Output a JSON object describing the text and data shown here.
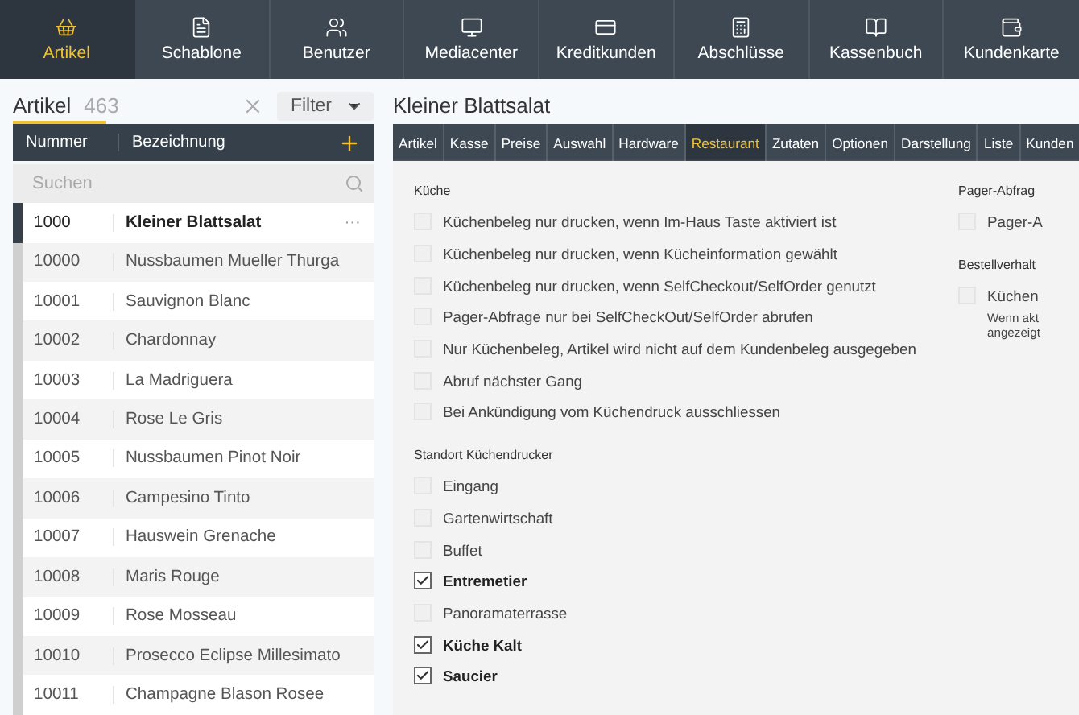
{
  "nav": [
    {
      "label": "Artikel",
      "selected": true
    },
    {
      "label": "Schablone",
      "selected": false
    },
    {
      "label": "Benutzer",
      "selected": false
    },
    {
      "label": "Mediacenter",
      "selected": false
    },
    {
      "label": "Kreditkunden",
      "selected": false
    },
    {
      "label": "Abschlüsse",
      "selected": false
    },
    {
      "label": "Kassenbuch",
      "selected": false
    },
    {
      "label": "Kundenkarte",
      "selected": false
    }
  ],
  "list": {
    "title": "Artikel",
    "count": "463",
    "filter": "Filter",
    "columns": [
      "Nummer",
      "Bezeichnung"
    ],
    "search": {
      "placeholder": "Suchen"
    },
    "rows": [
      {
        "number": "1000",
        "name": "Kleiner Blattsalat",
        "selected": true,
        "more": "···"
      },
      {
        "number": "10000",
        "name": "Nussbaumen Mueller Thurga",
        "selected": false
      },
      {
        "number": "10001",
        "name": "Sauvignon Blanc",
        "selected": false
      },
      {
        "number": "10002",
        "name": "Chardonnay",
        "selected": false
      },
      {
        "number": "10003",
        "name": "La Madriguera",
        "selected": false
      },
      {
        "number": "10004",
        "name": "Rose Le Gris",
        "selected": false
      },
      {
        "number": "10005",
        "name": "Nussbaumen Pinot Noir",
        "selected": false
      },
      {
        "number": "10006",
        "name": "Campesino Tinto",
        "selected": false
      },
      {
        "number": "10007",
        "name": "Hauswein Grenache",
        "selected": false
      },
      {
        "number": "10008",
        "name": "Maris Rouge",
        "selected": false
      },
      {
        "number": "10009",
        "name": "Rose Mosseau",
        "selected": false
      },
      {
        "number": "10010",
        "name": "Prosecco Eclipse Millesimato",
        "selected": false
      },
      {
        "number": "10011",
        "name": "Champagne Blason Rosee",
        "selected": false
      }
    ]
  },
  "detail": {
    "title": "Kleiner Blattsalat",
    "tabs": [
      {
        "label": "Artikel",
        "selected": false
      },
      {
        "label": "Kasse",
        "selected": false
      },
      {
        "label": "Preise",
        "selected": false
      },
      {
        "label": "Auswahl",
        "selected": false
      },
      {
        "label": "Hardware",
        "selected": false
      },
      {
        "label": "Restaurant",
        "selected": true
      },
      {
        "label": "Zutaten",
        "selected": false
      },
      {
        "label": "Optionen",
        "selected": false
      },
      {
        "label": "Darstellung",
        "selected": false
      },
      {
        "label": "Liste",
        "selected": false
      },
      {
        "label": "Kunden",
        "selected": false
      }
    ],
    "sections": [
      {
        "heading": "Küche",
        "options": [
          {
            "label": "Küchenbeleg nur drucken, wenn Im-Haus Taste aktiviert ist",
            "checked": false
          },
          {
            "label": "Küchenbeleg nur drucken, wenn Kücheinformation gewählt",
            "checked": false
          },
          {
            "label": "Küchenbeleg nur drucken, wenn SelfCheckout/SelfOrder genutzt",
            "checked": false
          },
          {
            "label": "Pager-Abfrage nur bei SelfCheckOut/SelfOrder abrufen",
            "checked": false
          },
          {
            "label": "Nur Küchenbeleg, Artikel wird nicht auf dem Kundenbeleg ausgegeben",
            "checked": false
          },
          {
            "label": "Abruf nächster Gang",
            "checked": false
          },
          {
            "label": "Bei Ankündigung vom Küchendruck ausschliessen",
            "checked": false
          }
        ]
      },
      {
        "heading": "Standort Küchendrucker",
        "options": [
          {
            "label": "Eingang",
            "checked": false
          },
          {
            "label": "Gartenwirtschaft",
            "checked": false
          },
          {
            "label": "Buffet",
            "checked": false
          },
          {
            "label": "Entremetier",
            "checked": true
          },
          {
            "label": "Panoramaterrasse",
            "checked": false
          },
          {
            "label": "Küche Kalt",
            "checked": true
          },
          {
            "label": "Saucier",
            "checked": true
          }
        ]
      }
    ],
    "side_sections": [
      {
        "heading": "Pager-Abfrag",
        "options": [
          {
            "label": "Pager-A",
            "checked": false
          }
        ]
      },
      {
        "heading": "Bestellverhalt",
        "options": [
          {
            "label": "Küchen",
            "checked": false,
            "description": [
              "Wenn akt",
              "angezeigt"
            ]
          }
        ]
      }
    ]
  }
}
